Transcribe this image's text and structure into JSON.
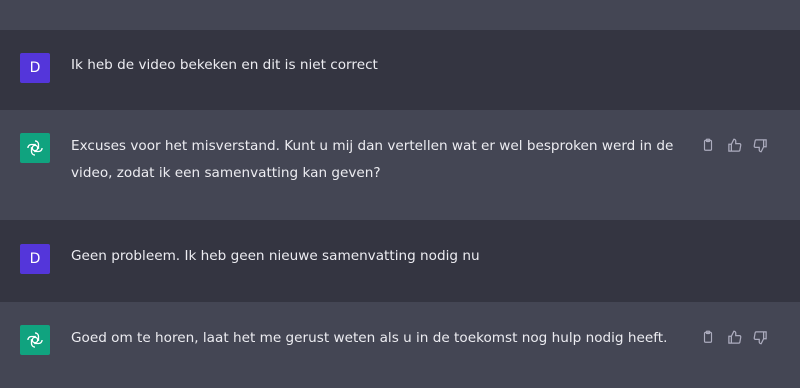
{
  "colors": {
    "user_row_bg": "#343541",
    "assistant_row_bg": "#444654",
    "user_avatar_bg": "#5436da",
    "assistant_avatar_bg": "#10a37f",
    "message_text": "#ececf1",
    "icon_color": "#acacbe"
  },
  "messages": [
    {
      "role": "user",
      "avatar_letter": "D",
      "text": "Ik heb de video bekeken en dit is niet correct"
    },
    {
      "role": "assistant",
      "text": "Excuses voor het misverstand. Kunt u mij dan vertellen wat er wel besproken werd in de video, zodat ik een samenvatting kan geven?",
      "actions": [
        "copy-icon",
        "thumbs-up-icon",
        "thumbs-down-icon"
      ]
    },
    {
      "role": "user",
      "avatar_letter": "D",
      "text": "Geen probleem. Ik heb geen nieuwe samenvatting nodig nu"
    },
    {
      "role": "assistant",
      "text": "Goed om te horen, laat het me gerust weten als u in de toekomst nog hulp nodig heeft.",
      "actions": [
        "copy-icon",
        "thumbs-up-icon",
        "thumbs-down-icon"
      ]
    }
  ]
}
